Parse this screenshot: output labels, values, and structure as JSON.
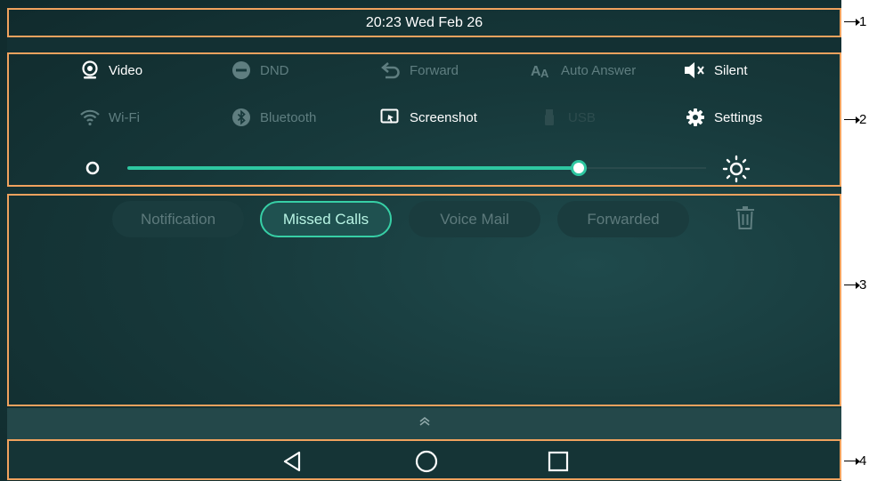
{
  "status_bar": {
    "datetime": "20:23 Wed Feb 26"
  },
  "quick_toggles": {
    "row1": [
      {
        "label": "Video",
        "icon": "webcam-icon",
        "state": "on"
      },
      {
        "label": "DND",
        "icon": "dnd-icon",
        "state": "off"
      },
      {
        "label": "Forward",
        "icon": "forward-arrow-icon",
        "state": "off"
      },
      {
        "label": "Auto Answer",
        "icon": "auto-answer-icon",
        "state": "off"
      },
      {
        "label": "Silent",
        "icon": "speaker-muted-icon",
        "state": "on"
      }
    ],
    "row2": [
      {
        "label": "Wi-Fi",
        "icon": "wifi-icon",
        "state": "off"
      },
      {
        "label": "Bluetooth",
        "icon": "bluetooth-icon",
        "state": "off"
      },
      {
        "label": "Screenshot",
        "icon": "screenshot-icon",
        "state": "on"
      },
      {
        "label": "USB",
        "icon": "usb-icon",
        "state": "off"
      },
      {
        "label": "Settings",
        "icon": "gear-icon",
        "state": "on"
      }
    ],
    "brightness": {
      "value_fraction": 0.78,
      "min_icon": "circle-outline-icon",
      "max_icon": "sun-icon"
    }
  },
  "notification_tabs": [
    {
      "label": "Notification",
      "active": false
    },
    {
      "label": "Missed Calls",
      "active": true
    },
    {
      "label": "Voice Mail",
      "active": false
    },
    {
      "label": "Forwarded",
      "active": false
    }
  ],
  "clear_icon": "trash-icon",
  "handle_icon": "double-chevron-up-icon",
  "nav_bar": {
    "buttons": [
      "back-triangle-icon",
      "home-circle-icon",
      "recents-square-icon"
    ]
  },
  "callouts": [
    "1",
    "2",
    "3",
    "4"
  ],
  "colors": {
    "accent": "#2ec7a1",
    "frame": "#f0a25e",
    "background": "#17393b",
    "inactive_text": "#5f7e80"
  }
}
